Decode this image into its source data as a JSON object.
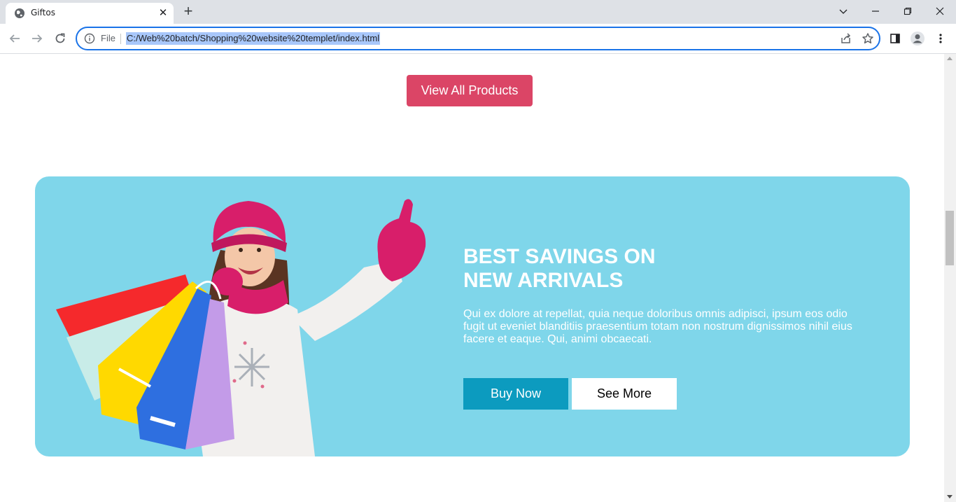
{
  "browser": {
    "tab_title": "Giftos",
    "scheme_label": "File",
    "url": "C:/Web%20batch/Shopping%20website%20templet/index.html"
  },
  "page": {
    "view_all_label": "View All Products",
    "banner": {
      "title_line1": "BEST SAVINGS ON",
      "title_line2": "NEW ARRIVALS",
      "description": "Qui ex dolore at repellat, quia neque doloribus omnis adipisci, ipsum eos odio fugit ut eveniet blanditiis praesentium totam non nostrum dignissimos nihil eius facere et eaque. Qui, animi obcaecati.",
      "buy_label": "Buy Now",
      "see_more_label": "See More"
    }
  },
  "colors": {
    "accent": "#db4566",
    "banner_bg": "#7fd6ea",
    "buy_button": "#0c9bbf",
    "omnibox_focus": "#1a73e8"
  },
  "icons": [
    "globe-icon",
    "close-icon",
    "plus-icon",
    "chevron-down-icon",
    "minimize-icon",
    "restore-icon",
    "window-close-icon",
    "back-icon",
    "forward-icon",
    "reload-icon",
    "info-icon",
    "share-icon",
    "star-icon",
    "side-panel-icon",
    "profile-icon",
    "more-icon"
  ]
}
